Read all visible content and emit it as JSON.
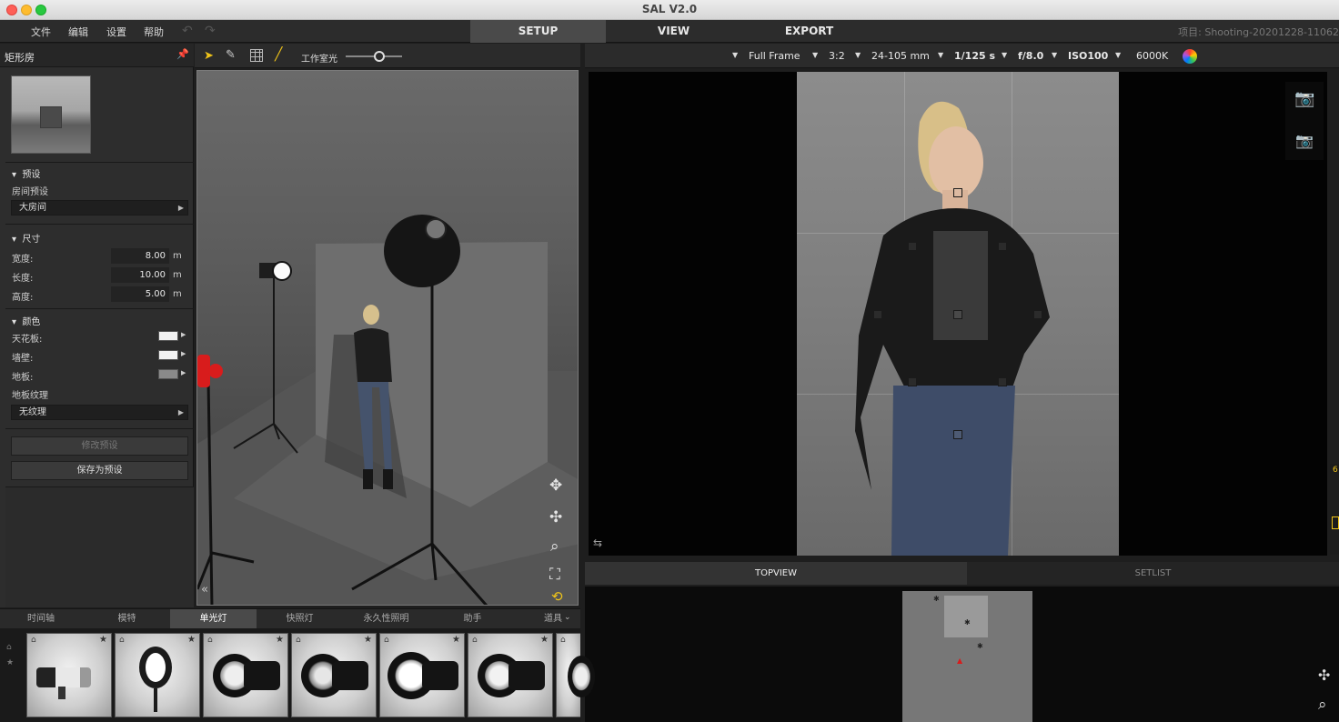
{
  "window": {
    "title": "SAL V2.0"
  },
  "menu": {
    "items": [
      "文件",
      "编辑",
      "设置",
      "帮助"
    ]
  },
  "modes": {
    "setup": "SETUP",
    "view": "VIEW",
    "export": "EXPORT"
  },
  "project": {
    "label": "项目: Shooting-20201228-11062"
  },
  "left_panel": {
    "title": "矩形房",
    "preset_section": "预设",
    "room_preset_label": "房间预设",
    "room_preset_value": "大房间",
    "size_section": "尺寸",
    "width_label": "宽度:",
    "width_value": "8.00",
    "length_label": "长度:",
    "length_value": "10.00",
    "height_label": "高度:",
    "height_value": "5.00",
    "unit": "m",
    "color_section": "颜色",
    "ceiling_label": "天花板:",
    "wall_label": "墙壁:",
    "floor_label": "地板:",
    "floor_texture_label": "地板纹理",
    "floor_texture_value": "无纹理",
    "modify_preset": "修改预设",
    "save_preset": "保存为预设",
    "ceiling_color": "#f2f2f2",
    "wall_color": "#f2f2f2",
    "floor_color": "#8a8a8a"
  },
  "viewport_toolbar": {
    "studio_light_label": "工作室光",
    "studio_light_level": 0.6
  },
  "camera": {
    "sensor": "Full Frame",
    "ratio": "3:2",
    "lens": "24-105 mm",
    "shutter": "1/125 s",
    "aperture": "f/8.0",
    "iso": "ISO100",
    "wb": "6000K"
  },
  "bottom_tabs": {
    "topview": "TOPVIEW",
    "setlist": "SETLIST"
  },
  "library_tabs": [
    "时间轴",
    "模特",
    "单光灯",
    "快照灯",
    "永久性照明",
    "助手",
    "道具"
  ],
  "library_active_tab": 2,
  "colors": {
    "accent_yellow": "#f0c419",
    "prop_red": "#d81c1c"
  }
}
